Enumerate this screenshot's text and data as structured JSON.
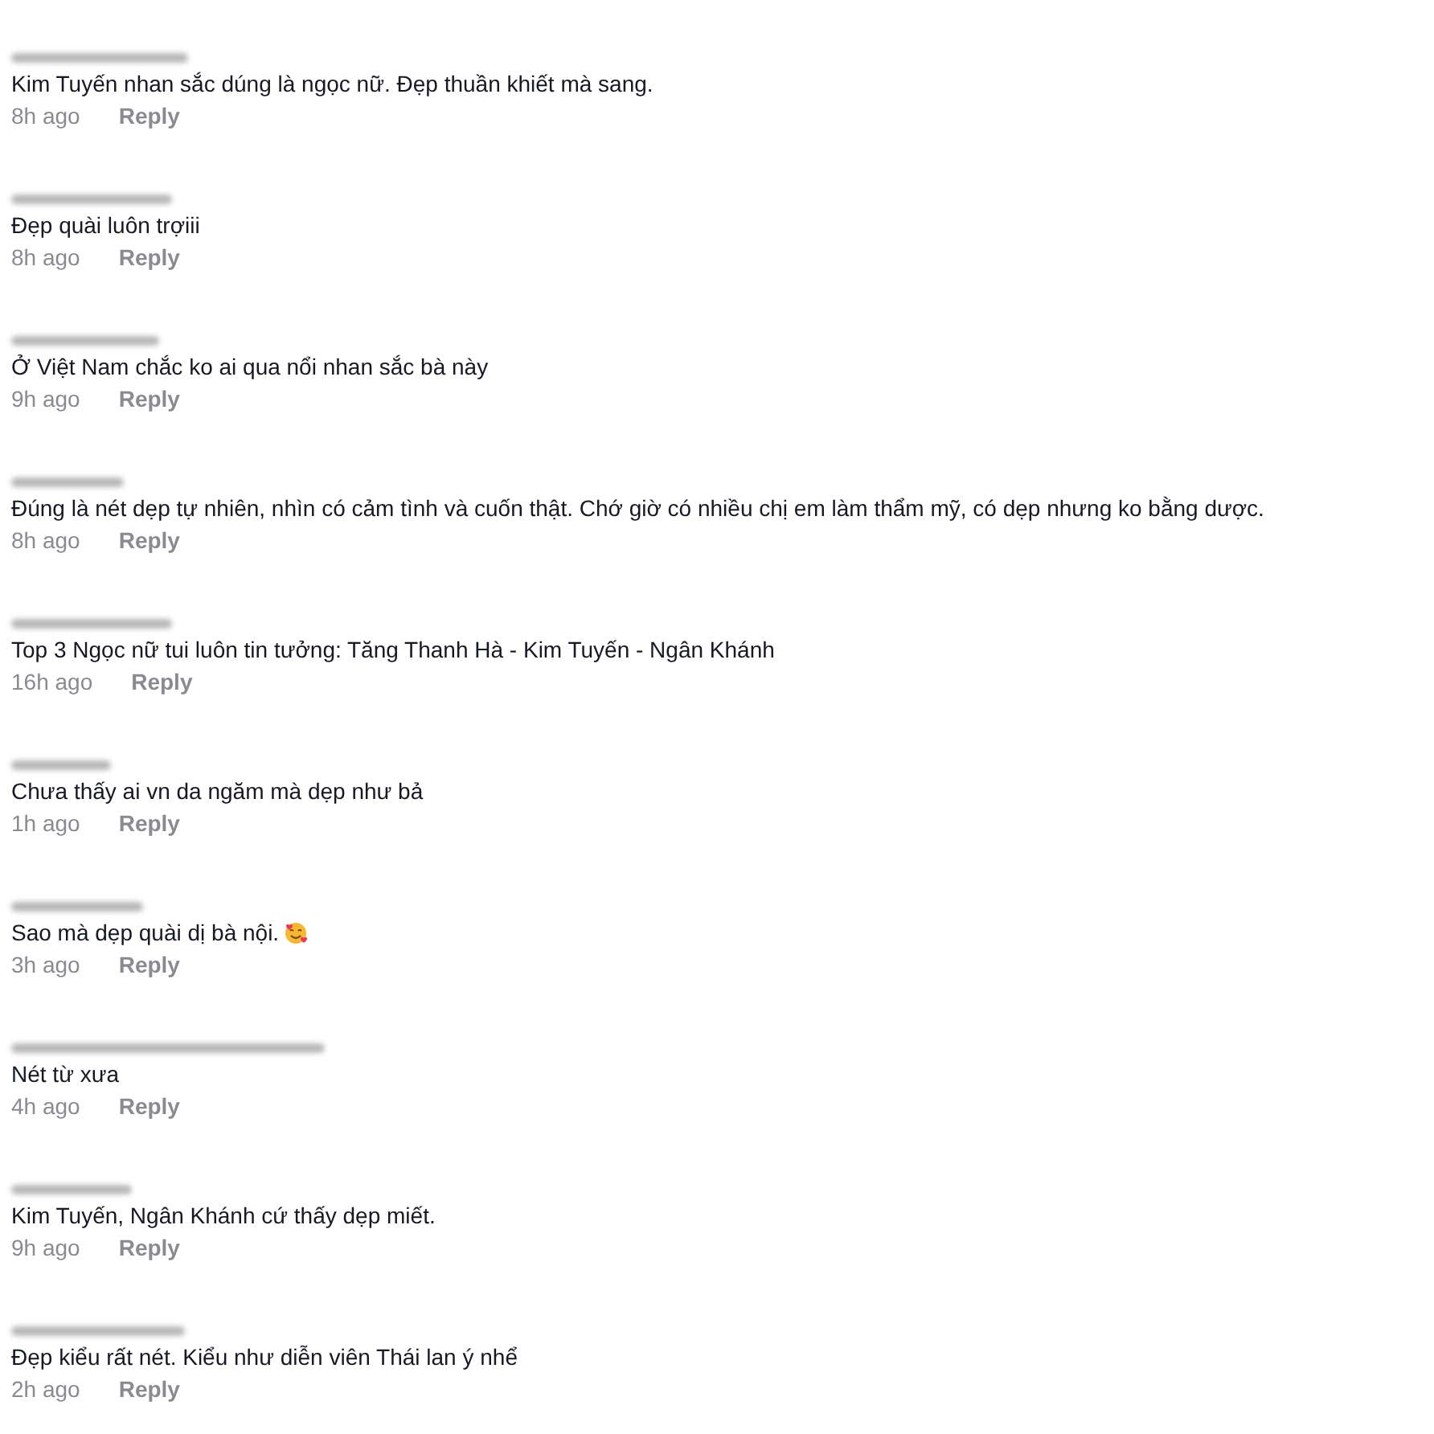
{
  "comments": [
    {
      "text": "Kim Tuyến nhan sắc dúng là ngọc nữ. Đẹp thuần khiết mà sang.",
      "time": "8h ago",
      "reply": "Reply"
    },
    {
      "text": "Đẹp quài luôn trợiii",
      "time": "8h ago",
      "reply": "Reply"
    },
    {
      "text": "Ở Việt Nam chắc ko ai qua nổi nhan sắc bà này",
      "time": "9h ago",
      "reply": "Reply"
    },
    {
      "text": "Đúng là nét dẹp tự nhiên, nhìn có cảm tình và cuốn thật. Chớ giờ có nhiều chị em làm thẩm mỹ, có dẹp nhưng ko bằng dược.",
      "time": "8h ago",
      "reply": "Reply"
    },
    {
      "text": "Top 3 Ngọc nữ tui luôn tin tưởng: Tăng Thanh Hà - Kim Tuyến - Ngân Khánh",
      "time": "16h ago",
      "reply": "Reply"
    },
    {
      "text": "Chưa thấy ai vn da ngăm mà dẹp như bả",
      "time": "1h ago",
      "reply": "Reply"
    },
    {
      "text": "Sao mà dẹp quài dị bà nội.",
      "emoji": true,
      "time": "3h ago",
      "reply": "Reply"
    },
    {
      "text": "Nét từ xưa",
      "time": "4h ago",
      "reply": "Reply"
    },
    {
      "text": "Kim Tuyến, Ngân Khánh cứ thấy dẹp miết.",
      "time": "9h ago",
      "reply": "Reply"
    },
    {
      "text": "Đẹp kiểu rất nét. Kiểu như diễn viên Thái lan ý nhể",
      "time": "2h ago",
      "reply": "Reply"
    }
  ]
}
